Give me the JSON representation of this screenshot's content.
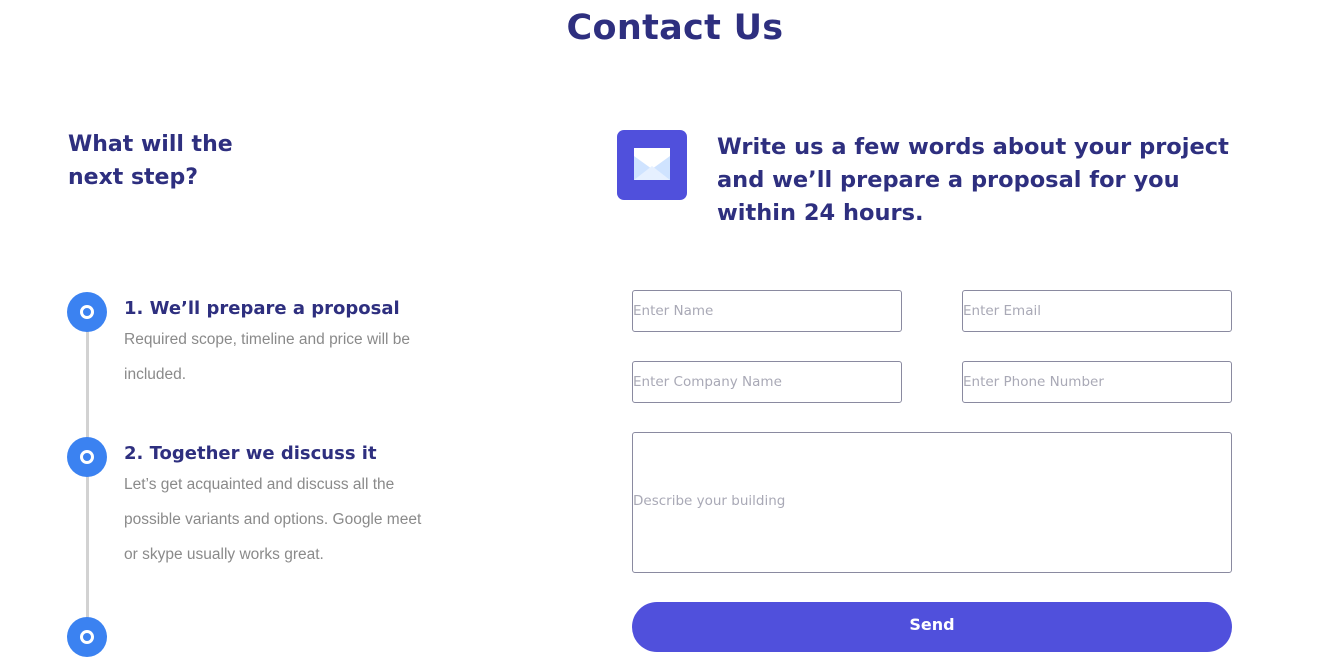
{
  "page": {
    "title": "Contact Us"
  },
  "left": {
    "heading_line1": "What will the",
    "heading_line2": "next step?",
    "steps": [
      {
        "title": "1. We’ll prepare a proposal",
        "description": "Required scope, timeline and price will be included."
      },
      {
        "title": "2. Together we discuss it",
        "description": "Let’s get acquainted and discuss all the possible variants and options. Google meet or skype usually works great."
      }
    ]
  },
  "right": {
    "icon": "envelope-icon",
    "heading": "Write us a few words about your project and we’ll prepare a proposal for you within 24 hours."
  },
  "form": {
    "name_placeholder": "Enter Name",
    "email_placeholder": "Enter Email",
    "company_placeholder": "Enter Company Name",
    "phone_placeholder": "Enter Phone Number",
    "description_placeholder": "Describe your building",
    "send_label": "Send"
  },
  "colors": {
    "heading": "#2e2f7f",
    "accent_blue": "#3b82f1",
    "button_purple": "#5050dc",
    "muted_text": "#8a8a8a"
  }
}
